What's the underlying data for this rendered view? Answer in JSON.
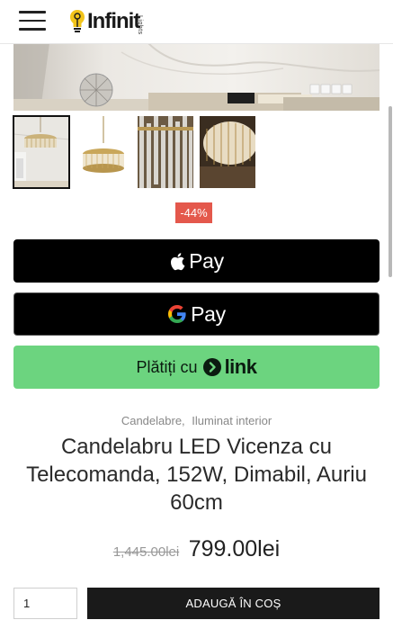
{
  "header": {
    "menu_icon": "hamburger-menu-icon",
    "logo": {
      "name": "Infinit",
      "sub": "Lights"
    }
  },
  "gallery": {
    "thumbnail_count": 4,
    "active_index": 0
  },
  "badge": {
    "discount": "-44%"
  },
  "payments": {
    "apple_pay_label": "Pay",
    "google_pay_label": "Pay",
    "link_prefix": "Plătiți cu",
    "link_word": "link"
  },
  "product": {
    "categories": [
      "Candelabre,",
      "Iluminat interior"
    ],
    "title": "Candelabru LED Vicenza cu Telecomanda, 152W, Dimabil, Auriu 60cm",
    "old_price": "1,445.00lei",
    "new_price": "799.00lei"
  },
  "cart": {
    "quantity": "1",
    "add_to_cart_label": "ADAUGĂ ÎN COȘ"
  },
  "colors": {
    "link_green": "#6cd47f",
    "discount_red": "#e4584c",
    "button_black": "#000000"
  }
}
